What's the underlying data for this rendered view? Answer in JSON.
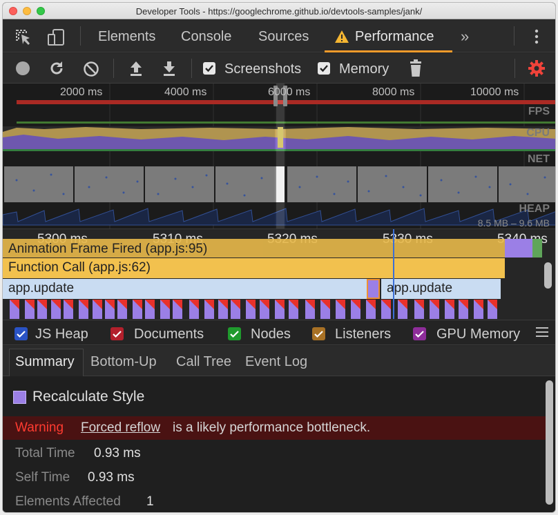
{
  "window": {
    "title": "Developer Tools - https://googlechrome.github.io/devtools-samples/jank/"
  },
  "tabs": [
    {
      "label": "Elements"
    },
    {
      "label": "Console"
    },
    {
      "label": "Sources"
    },
    {
      "label": "Performance",
      "active": true,
      "icon": "warning-icon"
    }
  ],
  "toolbar": {
    "screenshots_label": "Screenshots",
    "screenshots_checked": true,
    "memory_label": "Memory",
    "memory_checked": true
  },
  "overview": {
    "ticks": [
      "2000 ms",
      "4000 ms",
      "6000 ms",
      "8000 ms",
      "10000 ms"
    ],
    "tracks": {
      "fps": "FPS",
      "cpu": "CPU",
      "net": "NET",
      "heap": "HEAP"
    },
    "heap_range": "8.5 MB – 9.6 MB"
  },
  "flame": {
    "ticks": [
      "5300 ms",
      "5310 ms",
      "5320 ms",
      "5330 ms",
      "5340 ms"
    ],
    "animation_frame": "Animation Frame Fired (app.js:95)",
    "function_call": "Function Call (app.js:62)",
    "app_update_1": "app.update",
    "app_update_2": "app.update"
  },
  "legend": [
    {
      "label": "JS Heap",
      "color": "#2a53c5",
      "checked": true
    },
    {
      "label": "Documents",
      "color": "#b3202c",
      "checked": true
    },
    {
      "label": "Nodes",
      "color": "#1f9a2d",
      "checked": true
    },
    {
      "label": "Listeners",
      "color": "#a87125",
      "checked": true
    },
    {
      "label": "GPU Memory",
      "color": "#8e2d9a",
      "checked": true
    }
  ],
  "subtabs": [
    {
      "label": "Summary",
      "active": true
    },
    {
      "label": "Bottom-Up"
    },
    {
      "label": "Call Tree"
    },
    {
      "label": "Event Log"
    }
  ],
  "summary": {
    "event_name": "Recalculate Style",
    "event_color": "#9b7fe6",
    "warning_label": "Warning",
    "warning_link": "Forced reflow",
    "warning_text": "is a likely performance bottleneck.",
    "rows": [
      {
        "label": "Total Time",
        "value": "0.93 ms"
      },
      {
        "label": "Self Time",
        "value": "0.93 ms"
      },
      {
        "label": "Elements Affected",
        "value": "1"
      }
    ]
  },
  "colors": {
    "accent": "#f59b2b",
    "scripting": "#f2c14e",
    "rendering": "#9b7fe6",
    "warning": "#ff3b30",
    "settings": "#f0433a"
  }
}
